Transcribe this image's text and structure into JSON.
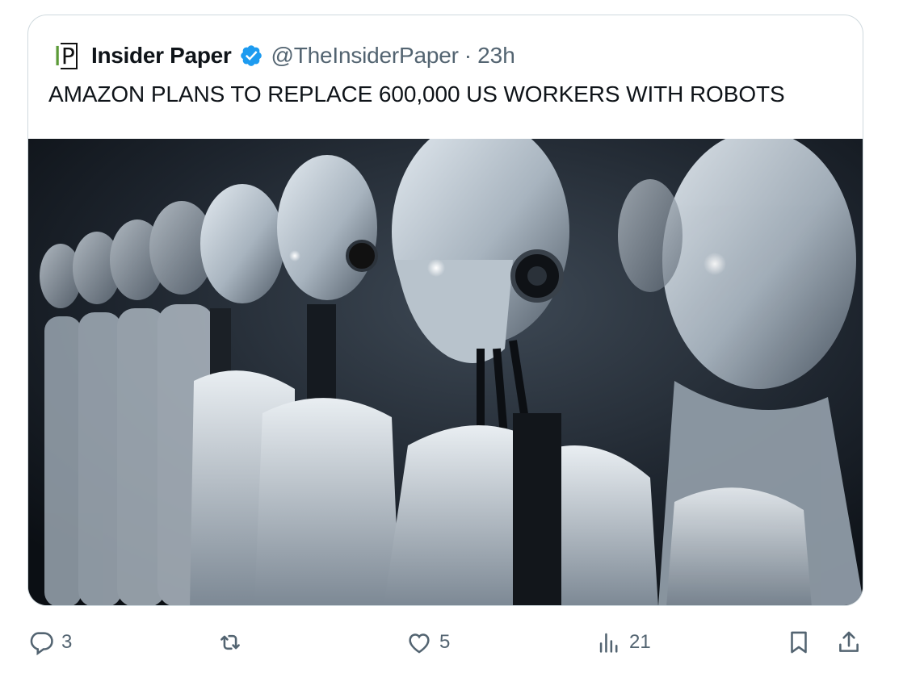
{
  "quoted_tweet": {
    "logo_text_primary": "I",
    "logo_text_secondary": "P",
    "author_name": "Insider Paper",
    "handle": "@TheInsiderPaper",
    "separator": "·",
    "timestamp": "23h",
    "text": "AMAZON PLANS TO REPLACE 600,000 US WORKERS WITH ROBOTS",
    "image_icon": "robots-photo"
  },
  "actions": {
    "reply": {
      "icon": "reply-icon",
      "count": "3"
    },
    "retweet": {
      "icon": "retweet-icon",
      "count": ""
    },
    "like": {
      "icon": "heart-icon",
      "count": "5"
    },
    "views": {
      "icon": "views-icon",
      "count": "21"
    },
    "bookmark": {
      "icon": "bookmark-icon"
    },
    "share": {
      "icon": "share-icon"
    }
  },
  "colors": {
    "verified_blue": "#1d9bf0",
    "muted_text": "#536471",
    "logo_green": "#5b9a37"
  }
}
